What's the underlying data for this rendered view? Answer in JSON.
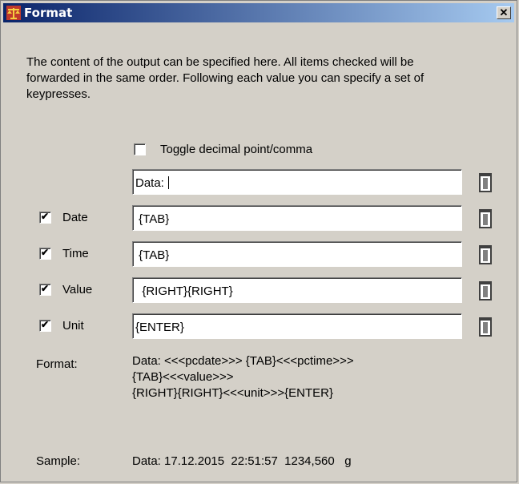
{
  "window": {
    "title": "Format",
    "icon": "scale-icon",
    "close_label": "✕"
  },
  "description": "The content of the output can be specified here. All items checked will be forwarded in the same order. Following each value you can specify a set of keypresses.",
  "toggle": {
    "label": "Toggle decimal point/comma",
    "checked": false
  },
  "prefix_field": {
    "value": "Data: "
  },
  "rows": [
    {
      "label": "Date",
      "checked": true,
      "value": " {TAB}"
    },
    {
      "label": "Time",
      "checked": true,
      "value": " {TAB}"
    },
    {
      "label": "Value",
      "checked": true,
      "value": "  {RIGHT}{RIGHT}"
    },
    {
      "label": "Unit",
      "checked": true,
      "value": "{ENTER}"
    }
  ],
  "format": {
    "label": "Format:",
    "lines": [
      "Data: <<<pcdate>>>  {TAB}<<<pctime>>>",
      "{TAB}<<<value>>>",
      "{RIGHT}{RIGHT}<<<unit>>>{ENTER}"
    ]
  },
  "sample": {
    "label": "Sample:",
    "value": "Data: 17.12.2015  22:51:57  1234,560   g"
  },
  "icons": {
    "delete": "trash-icon"
  }
}
